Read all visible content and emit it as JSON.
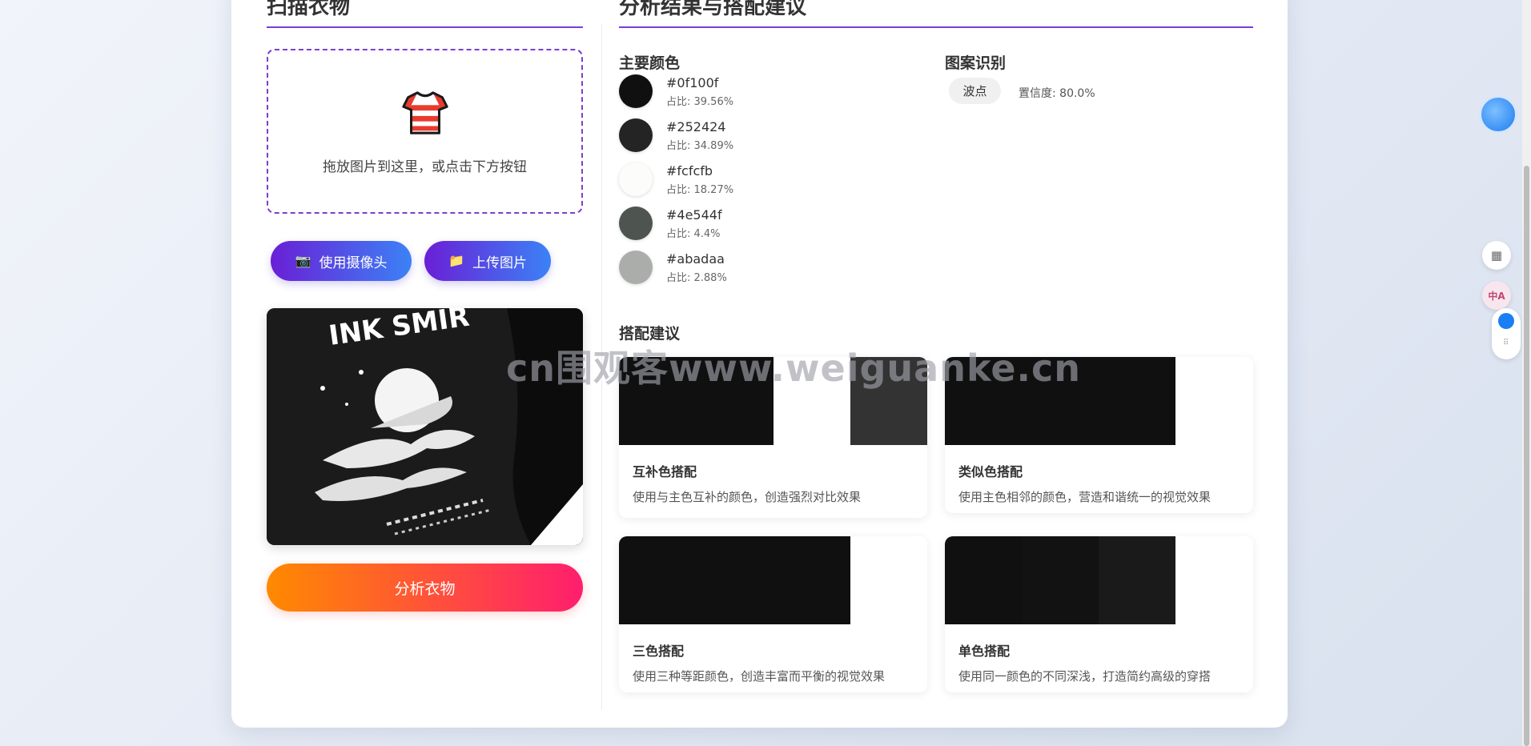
{
  "left": {
    "title": "扫描衣物",
    "dropzone_hint": "拖放图片到这里，或点击下方按钮",
    "camera_button": "使用摄像头",
    "upload_button": "上传图片",
    "analyze_button": "分析衣物",
    "preview_text": "INK SMIR"
  },
  "right": {
    "title": "分析结果与搭配建议",
    "colors_title": "主要颜色",
    "colors": [
      {
        "hex": "#0f100f",
        "pct": "占比: 39.56%"
      },
      {
        "hex": "#252424",
        "pct": "占比: 34.89%"
      },
      {
        "hex": "#fcfcfb",
        "pct": "占比: 18.27%"
      },
      {
        "hex": "#4e544f",
        "pct": "占比: 4.4%"
      },
      {
        "hex": "#abadaa",
        "pct": "占比: 2.88%"
      }
    ],
    "pattern_title": "图案识别",
    "pattern_tag": "波点",
    "pattern_confidence": "置信度: 80.0%",
    "suggest_title": "搭配建议",
    "suggestions": [
      {
        "name": "互补色搭配",
        "desc": "使用与主色互补的颜色，创造强烈对比效果",
        "palette": [
          "#0f100f",
          "#ffffff",
          "#333333"
        ]
      },
      {
        "name": "类似色搭配",
        "desc": "使用主色相邻的颜色，营造和谐统一的视觉效果",
        "palette": [
          "#0f100f",
          "#0f100f",
          "#0f100f"
        ]
      },
      {
        "name": "三色搭配",
        "desc": "使用三种等距颜色，创造丰富而平衡的视觉效果",
        "palette": [
          "#0f100f",
          "#0f100f",
          "#0f100f"
        ]
      },
      {
        "name": "单色搭配",
        "desc": "使用同一颜色的不同深浅，打造简约高级的穿搭",
        "palette": [
          "#0f100f",
          "#121212",
          "#1a1a1a"
        ]
      }
    ]
  },
  "watermark": "cn围观客www.weiguanke.cn",
  "side": {
    "translate_label": "中A"
  },
  "icons": {
    "shirt": "shirt-icon",
    "camera": "camera-icon",
    "folder": "folder-icon",
    "apps": "apps-add-icon",
    "translate": "translate-icon",
    "chat": "chat-bubble-icon",
    "grip": "drag-grip-icon"
  },
  "colors": {
    "accent": "#7a3fd1",
    "button_gradient_start": "#6a1fd6",
    "button_gradient_end": "#3b82f6",
    "analyze_gradient_start": "#ff8a00",
    "analyze_gradient_end": "#ff1e6e"
  }
}
